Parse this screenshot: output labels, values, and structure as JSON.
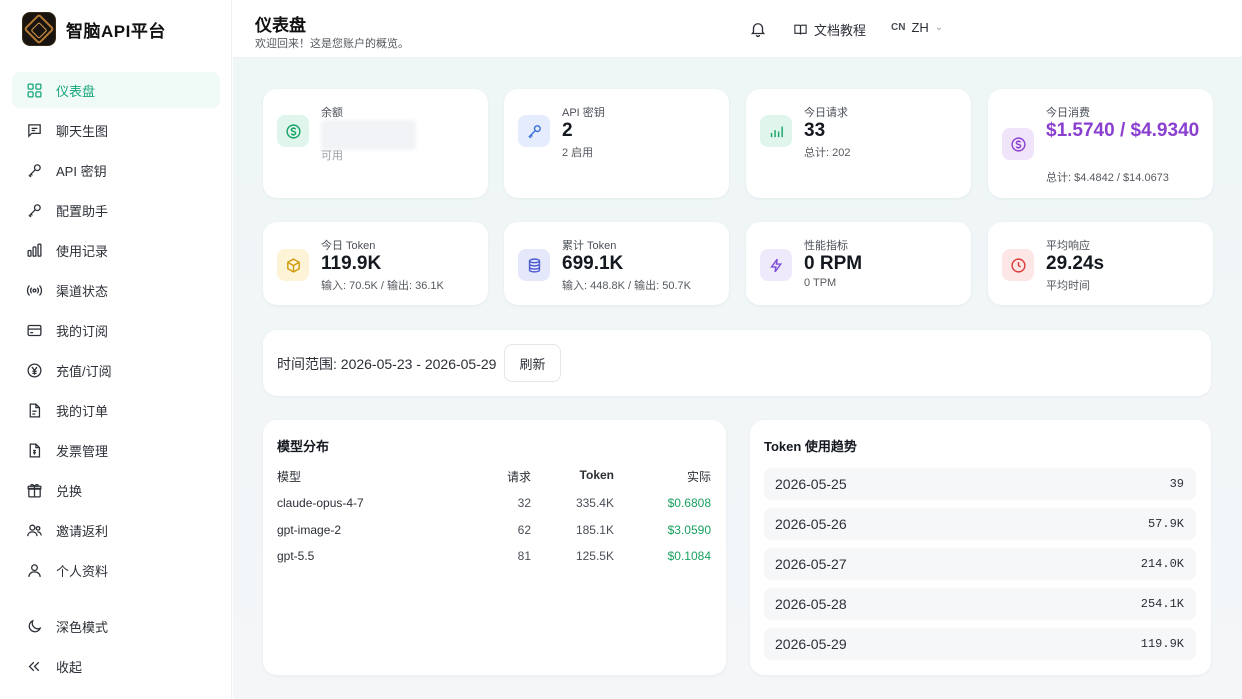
{
  "brand": {
    "name": "智脑API平台"
  },
  "sidebar": {
    "items": [
      {
        "label": "仪表盘",
        "icon": "grid-icon"
      },
      {
        "label": "聊天生图",
        "icon": "chat-icon"
      },
      {
        "label": "API 密钥",
        "icon": "key-icon"
      },
      {
        "label": "配置助手",
        "icon": "key-icon"
      },
      {
        "label": "使用记录",
        "icon": "bar-chart-icon"
      },
      {
        "label": "渠道状态",
        "icon": "signal-icon"
      },
      {
        "label": "我的订阅",
        "icon": "card-icon"
      },
      {
        "label": "充值/订阅",
        "icon": "yen-icon"
      },
      {
        "label": "我的订单",
        "icon": "document-icon"
      },
      {
        "label": "发票管理",
        "icon": "invoice-icon"
      },
      {
        "label": "兑换",
        "icon": "gift-icon"
      },
      {
        "label": "邀请返利",
        "icon": "users-icon"
      },
      {
        "label": "个人资料",
        "icon": "user-icon"
      }
    ],
    "bottom": [
      {
        "label": "深色模式",
        "icon": "moon-icon"
      },
      {
        "label": "收起",
        "icon": "chevrons-left-icon"
      }
    ],
    "active_color": "#14a57a"
  },
  "header": {
    "title": "仪表盘",
    "subtitle": "欢迎回来！这是您账户的概览。",
    "docs_label": "文档教程",
    "lang_flag": "CN",
    "lang_label": "ZH"
  },
  "stats": {
    "balance": {
      "label": "余额",
      "value": "",
      "sub": "可用"
    },
    "api_keys": {
      "label": "API 密钥",
      "value": "2",
      "sub": "2 启用"
    },
    "today_requests": {
      "label": "今日请求",
      "value": "33",
      "sub": "总计: 202"
    },
    "today_spend": {
      "label": "今日消费",
      "value": "$1.5740 / $4.9340",
      "sub": "总计: $4.4842 / $14.0673",
      "color": "#8a3fcf"
    },
    "today_tokens": {
      "label": "今日 Token",
      "value": "119.9K",
      "sub": "输入: 70.5K / 输出: 36.1K"
    },
    "total_tokens": {
      "label": "累计 Token",
      "value": "699.1K",
      "sub": "输入: 448.8K / 输出: 50.7K"
    },
    "performance": {
      "label": "性能指标",
      "value": "0 RPM",
      "sub": "0 TPM"
    },
    "avg_response": {
      "label": "平均响应",
      "value": "29.24s",
      "sub": "平均时间"
    }
  },
  "range": {
    "text": "时间范围: 2026-05-23 - 2026-05-29",
    "refresh_label": "刷新"
  },
  "model_distribution": {
    "title": "模型分布",
    "columns": [
      "模型",
      "请求",
      "Token",
      "实际"
    ],
    "rows": [
      {
        "model": "claude-opus-4-7",
        "requests": "32",
        "tokens": "335.4K",
        "cost": "$0.6808"
      },
      {
        "model": "gpt-image-2",
        "requests": "62",
        "tokens": "185.1K",
        "cost": "$3.0590"
      },
      {
        "model": "gpt-5.5",
        "requests": "81",
        "tokens": "125.5K",
        "cost": "$0.1084"
      }
    ]
  },
  "token_trend": {
    "title": "Token 使用趋势",
    "rows": [
      {
        "date": "2026-05-25",
        "value": "39"
      },
      {
        "date": "2026-05-26",
        "value": "57.9K"
      },
      {
        "date": "2026-05-27",
        "value": "214.0K"
      },
      {
        "date": "2026-05-28",
        "value": "254.1K"
      },
      {
        "date": "2026-05-29",
        "value": "119.9K"
      }
    ]
  }
}
